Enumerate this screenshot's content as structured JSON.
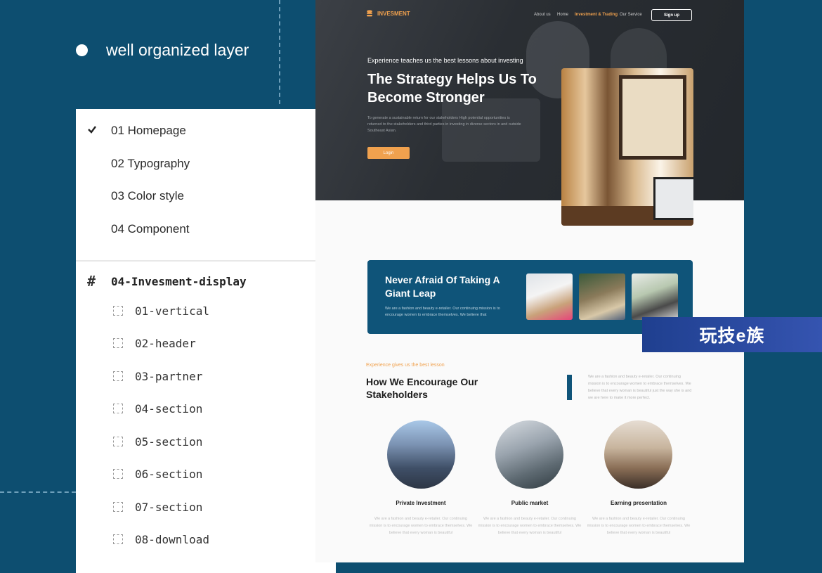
{
  "tagline": "well organized layer",
  "pages": [
    {
      "label": "01 Homepage",
      "checked": true
    },
    {
      "label": "02 Typography",
      "checked": false
    },
    {
      "label": "03 Color style",
      "checked": false
    },
    {
      "label": "04 Component",
      "checked": false
    }
  ],
  "frame": {
    "label": "04-Invesment-display"
  },
  "layers": [
    "01-vertical",
    "02-header",
    "03-partner",
    "04-section",
    "05-section",
    "06-section",
    "07-section",
    "08-download"
  ],
  "site": {
    "logo": "INVESMENT",
    "nav": [
      "About us",
      "Home",
      "Investment & Trading",
      "Our Service"
    ],
    "signup": "Sign up",
    "hero": {
      "pre": "Experience teaches us the best lessons about investing",
      "title": "The Strategy Helps Us To Become Stronger",
      "desc": "To generate a sustainable return for our stakeholders High potential opportunities is returned to the stakeholders and third parties in investing in diverse sectors in and outside Southeast Asian.",
      "login": "Login"
    },
    "banner": {
      "title": "Never Afraid Of Taking A Giant Leap",
      "desc": "We are a fashion and beauty e-retailer. Our continuing mission is to encourage women to embrace themselves. We believe that"
    },
    "section": {
      "sub": "Experience gives us the best lesson",
      "title": "How We Encourage Our Stakeholders",
      "desc": "We are a fashion and beauty e-retailer. Our continuing mission is to encourage women to embrace themselves. We believe that every woman is beautiful just the way she is and we are here to make it more perfect."
    },
    "cards": [
      {
        "title": "Private Investment",
        "desc": "We are a fashion and beauty e-retailer. Our continuing mission is to encourage women to embrace themselves. We believe that every woman is beautiful"
      },
      {
        "title": "Public market",
        "desc": "We are a fashion and beauty e-retailer. Our continuing mission is to encourage women to embrace themselves. We believe that every woman is beautiful"
      },
      {
        "title": "Earning presentation",
        "desc": "We are a fashion and beauty e-retailer. Our continuing mission is to encourage women to embrace themselves. We believe that every woman is beautiful"
      }
    ]
  },
  "watermark": "玩技e族",
  "colors": {
    "background": "#0d4e70",
    "accent": "#f0a14e",
    "brand": "#0f5479"
  }
}
